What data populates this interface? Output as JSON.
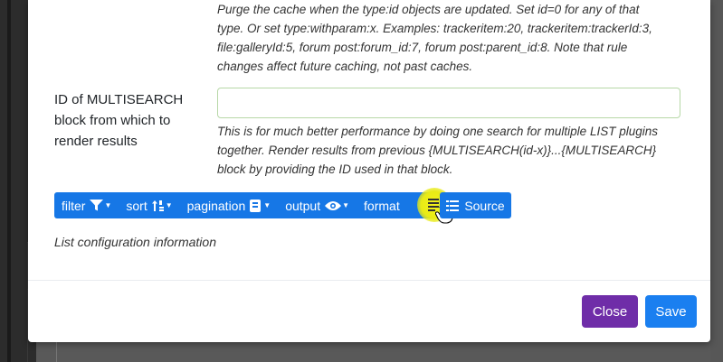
{
  "modal": {
    "help_top_lines": [
      "Purge the cache when the type:id objects are updated. Set id=0 for any of that",
      "type. Or set type:withparam:x. Examples: trackeritem:20, trackeritem:trackerId:3,",
      "file:galleryId:5, forum post:forum_id:7, forum post:parent_id:8. Note that rule",
      "changes affect future caching, not past caches."
    ],
    "field": {
      "label": "ID of MULTISEARCH block from which to render results",
      "value": "",
      "help_lines": [
        "This is for much better performance by doing one search for multiple LIST plugins",
        "together. Render results from previous {MULTISEARCH(id-x)}...{MULTISEARCH}",
        "block by providing the ID used in that block."
      ]
    },
    "toolbar": {
      "items": [
        {
          "label": "filter",
          "icon": "filter-icon"
        },
        {
          "label": "sort",
          "icon": "sort-icon"
        },
        {
          "label": "pagination",
          "icon": "pagination-icon"
        },
        {
          "label": "output",
          "icon": "eye-icon"
        },
        {
          "label": "format",
          "icon": "format-icon"
        }
      ],
      "source_label": "Source",
      "source_icon": "list-icon"
    },
    "list_info": "List configuration information",
    "footer": {
      "close_label": "Close",
      "save_label": "Save"
    }
  },
  "colors": {
    "primary": "#1677e6",
    "close": "#6f2da8",
    "highlight": "#f4f21a"
  }
}
